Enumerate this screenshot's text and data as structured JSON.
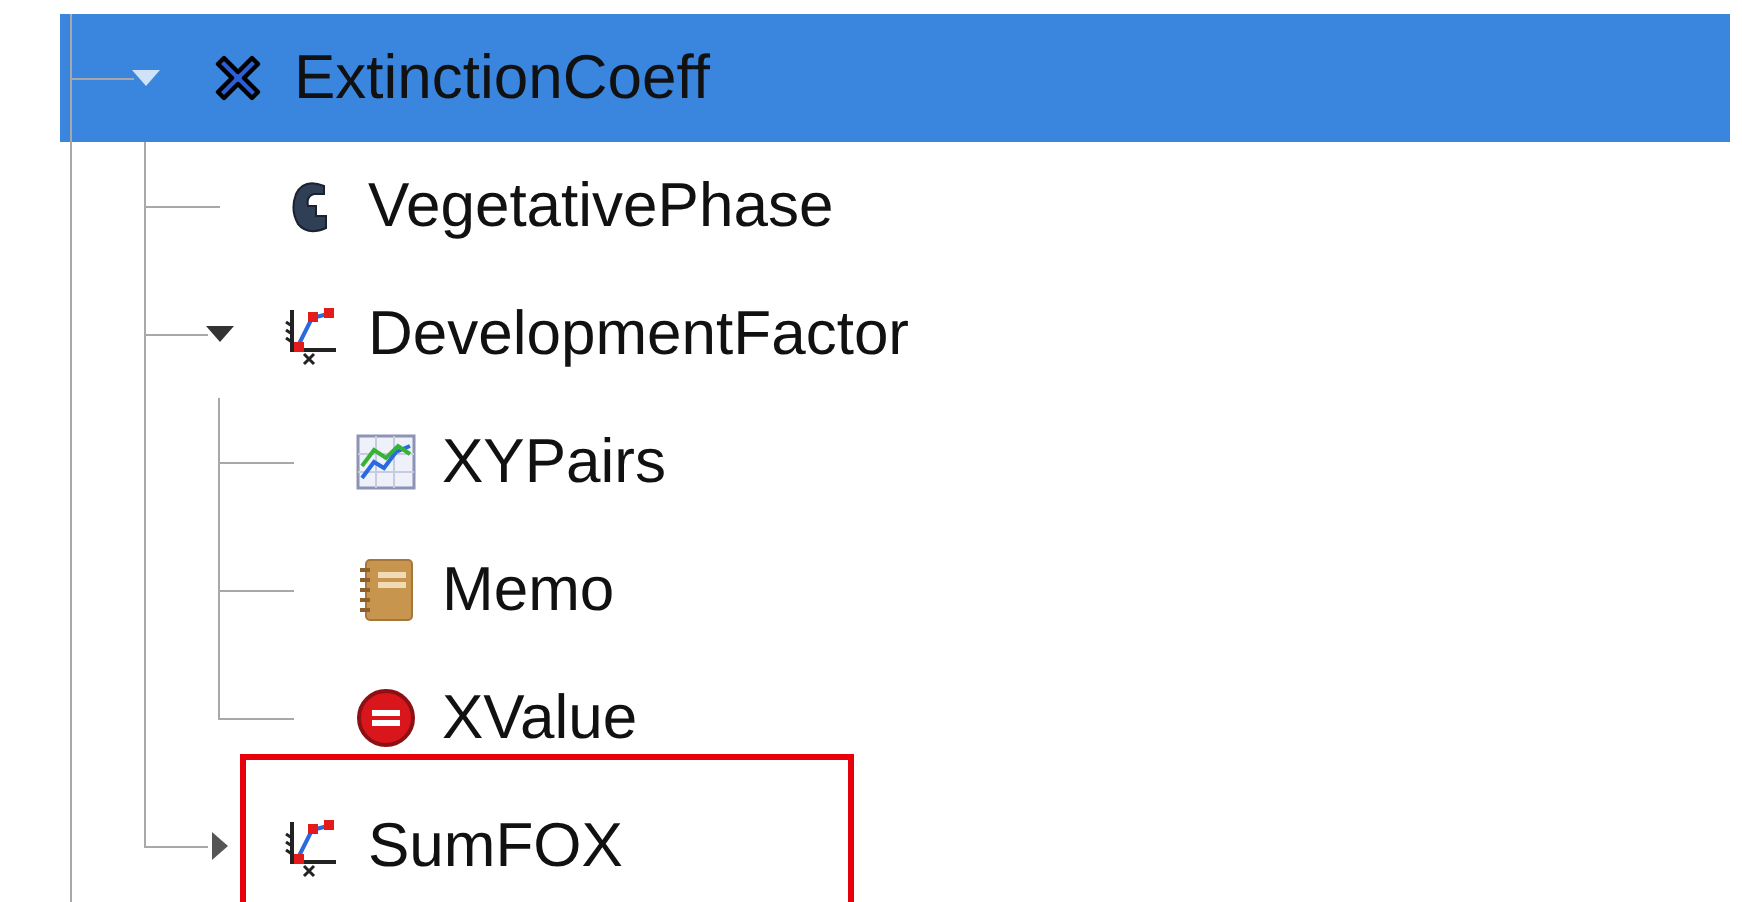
{
  "tree": [
    {
      "label": "ExtinctionCoeff",
      "kind": "multiply",
      "selected": true,
      "expanded": true,
      "children": [
        {
          "label": "VegetativePhase",
          "kind": "phase",
          "selected": false
        },
        {
          "label": "DevelopmentFactor",
          "kind": "interpolate",
          "selected": false,
          "expanded": true,
          "children": [
            {
              "label": "XYPairs",
              "kind": "xypairs",
              "selected": false
            },
            {
              "label": "Memo",
              "kind": "memo",
              "selected": false
            },
            {
              "label": "XValue",
              "kind": "variable",
              "selected": false
            }
          ]
        },
        {
          "label": "SumFOX",
          "kind": "interpolate",
          "selected": false,
          "expanded": false,
          "annotated": true,
          "has_children": true
        }
      ]
    }
  ]
}
